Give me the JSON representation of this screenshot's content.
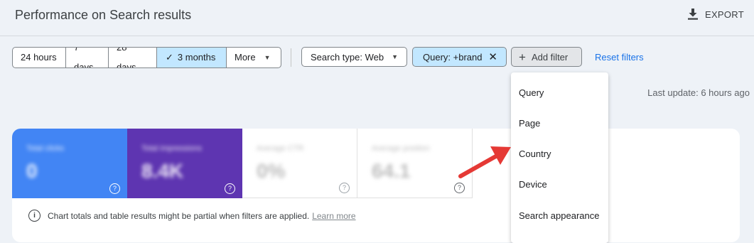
{
  "header": {
    "title": "Performance on Search results",
    "export_label": "EXPORT"
  },
  "date_range": {
    "options": [
      "24 hours",
      "7 days",
      "28 days",
      "3 months"
    ],
    "selected": "3 months",
    "more_label": "More"
  },
  "filters": {
    "search_type": "Search type: Web",
    "query": "Query: +brand",
    "add_filter": "Add filter",
    "reset": "Reset filters"
  },
  "last_update": "Last update: 6 hours ago",
  "metrics": [
    {
      "label": "Total clicks",
      "value": "0",
      "color": "#4285f4"
    },
    {
      "label": "Total impressions",
      "value": "8.4K",
      "color": "#5e35b1"
    },
    {
      "label": "Average CTR",
      "value": "0%",
      "color": "#ffffff"
    },
    {
      "label": "Average position",
      "value": "64.1",
      "color": "#ffffff"
    }
  ],
  "notice": {
    "text": "Chart totals and table results might be partial when filters are applied.",
    "link": "Learn more"
  },
  "add_filter_menu": [
    "Query",
    "Page",
    "Country",
    "Device",
    "Search appearance"
  ],
  "annotation": {
    "color": "#e53935"
  }
}
